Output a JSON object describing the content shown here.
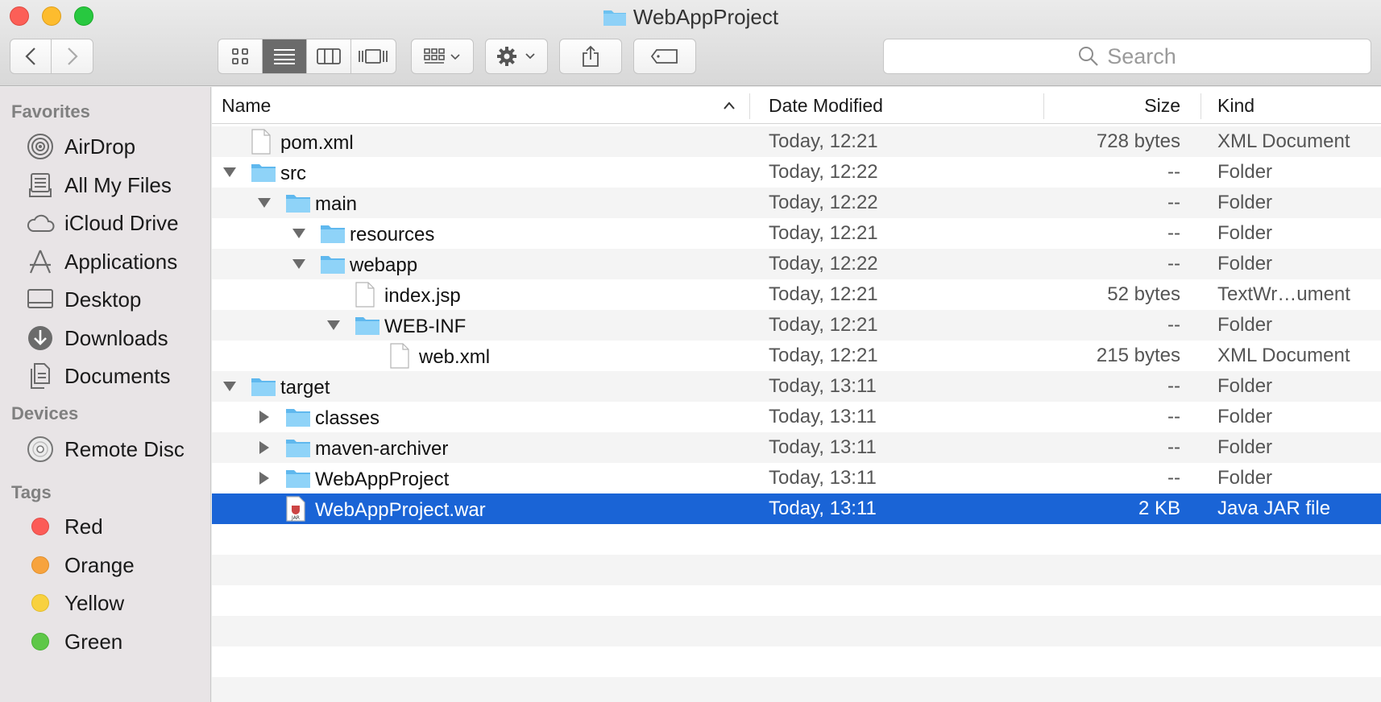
{
  "window": {
    "title": "WebAppProject"
  },
  "toolbar": {
    "back_icon": "chevron-left-icon",
    "forward_icon": "chevron-right-icon",
    "view_modes": [
      "icon-view",
      "list-view",
      "column-view",
      "cover-flow-view"
    ],
    "active_view": "list-view",
    "search_placeholder": "Search"
  },
  "sidebar": {
    "favorites_header": "Favorites",
    "favorites": [
      {
        "label": "AirDrop",
        "icon": "airdrop-icon"
      },
      {
        "label": "All My Files",
        "icon": "all-my-files-icon"
      },
      {
        "label": "iCloud Drive",
        "icon": "cloud-icon"
      },
      {
        "label": "Applications",
        "icon": "applications-icon"
      },
      {
        "label": "Desktop",
        "icon": "desktop-icon"
      },
      {
        "label": "Downloads",
        "icon": "downloads-icon"
      },
      {
        "label": "Documents",
        "icon": "documents-icon"
      }
    ],
    "devices_header": "Devices",
    "devices": [
      {
        "label": "Remote Disc",
        "icon": "disc-icon"
      }
    ],
    "tags_header": "Tags",
    "tags": [
      {
        "label": "Red",
        "color": "#fc5b57"
      },
      {
        "label": "Orange",
        "color": "#f7a33e"
      },
      {
        "label": "Yellow",
        "color": "#f8d13f"
      },
      {
        "label": "Green",
        "color": "#5ec748"
      }
    ]
  },
  "columns": {
    "name": "Name",
    "date": "Date Modified",
    "size": "Size",
    "kind": "Kind"
  },
  "files": [
    {
      "name": "pom.xml",
      "date": "Today, 12:21",
      "size": "728 bytes",
      "kind": "XML Document",
      "type": "file",
      "depth": 0,
      "disclosure": "none"
    },
    {
      "name": "src",
      "date": "Today, 12:22",
      "size": "--",
      "kind": "Folder",
      "type": "folder",
      "depth": 0,
      "disclosure": "open"
    },
    {
      "name": "main",
      "date": "Today, 12:22",
      "size": "--",
      "kind": "Folder",
      "type": "folder",
      "depth": 1,
      "disclosure": "open"
    },
    {
      "name": "resources",
      "date": "Today, 12:21",
      "size": "--",
      "kind": "Folder",
      "type": "folder",
      "depth": 2,
      "disclosure": "open"
    },
    {
      "name": "webapp",
      "date": "Today, 12:22",
      "size": "--",
      "kind": "Folder",
      "type": "folder",
      "depth": 2,
      "disclosure": "open"
    },
    {
      "name": "index.jsp",
      "date": "Today, 12:21",
      "size": "52 bytes",
      "kind": "TextWr…ument",
      "type": "file",
      "depth": 3,
      "disclosure": "none"
    },
    {
      "name": "WEB-INF",
      "date": "Today, 12:21",
      "size": "--",
      "kind": "Folder",
      "type": "folder",
      "depth": 3,
      "disclosure": "open"
    },
    {
      "name": "web.xml",
      "date": "Today, 12:21",
      "size": "215 bytes",
      "kind": "XML Document",
      "type": "file",
      "depth": 4,
      "disclosure": "none"
    },
    {
      "name": "target",
      "date": "Today, 13:11",
      "size": "--",
      "kind": "Folder",
      "type": "folder",
      "depth": 0,
      "disclosure": "open"
    },
    {
      "name": "classes",
      "date": "Today, 13:11",
      "size": "--",
      "kind": "Folder",
      "type": "folder",
      "depth": 1,
      "disclosure": "closed"
    },
    {
      "name": "maven-archiver",
      "date": "Today, 13:11",
      "size": "--",
      "kind": "Folder",
      "type": "folder",
      "depth": 1,
      "disclosure": "closed"
    },
    {
      "name": "WebAppProject",
      "date": "Today, 13:11",
      "size": "--",
      "kind": "Folder",
      "type": "folder",
      "depth": 1,
      "disclosure": "closed"
    },
    {
      "name": "WebAppProject.war",
      "date": "Today, 13:11",
      "size": "2 KB",
      "kind": "Java JAR file",
      "type": "jar",
      "depth": 1,
      "disclosure": "none",
      "selected": true
    }
  ]
}
